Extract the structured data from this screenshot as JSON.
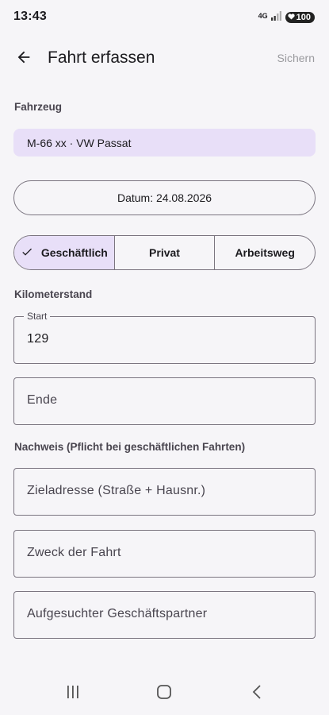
{
  "status_bar": {
    "time": "13:43",
    "network": "4G",
    "battery": "100"
  },
  "app_bar": {
    "title": "Fahrt erfassen",
    "save_label": "Sichern"
  },
  "vehicle": {
    "section_label": "Fahrzeug",
    "selected": "M-66 xx · VW Passat"
  },
  "date_button": "Datum: 24.08.2026",
  "trip_type": {
    "options": [
      "Geschäftlich",
      "Privat",
      "Arbeitsweg"
    ],
    "selected": "Geschäftlich"
  },
  "odometer": {
    "section_label": "Kilometerstand",
    "start_label": "Start",
    "start_value": "129",
    "end_placeholder": "Ende"
  },
  "proof": {
    "section_label": "Nachweis (Pflicht bei geschäftlichen Fahrten)",
    "destination_placeholder": "Zieladresse (Straße + Hausnr.)",
    "purpose_placeholder": "Zweck der Fahrt",
    "partner_placeholder": "Aufgesuchter Geschäftspartner"
  },
  "colors": {
    "accent_container": "#e8dff8",
    "outline": "#7b7580",
    "background": "#f6f5f8"
  }
}
